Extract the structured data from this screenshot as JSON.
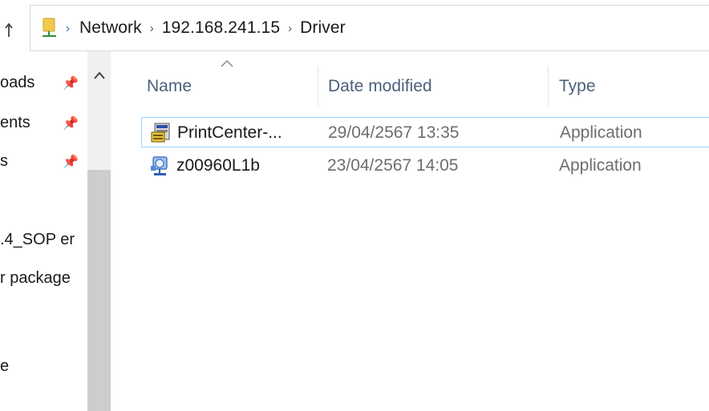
{
  "address": {
    "segments": [
      "Network",
      "192.168.241.15",
      "Driver"
    ]
  },
  "nav": {
    "items": [
      {
        "label": "oads",
        "pinned": true
      },
      {
        "label": "ents",
        "pinned": true
      },
      {
        "label": "s",
        "pinned": true
      },
      {
        "label": ".4_SOP er",
        "pinned": false
      },
      {
        "label": "r package",
        "pinned": false
      },
      {
        "label": "e",
        "pinned": false
      }
    ]
  },
  "columns": {
    "name": "Name",
    "date": "Date modified",
    "type": "Type"
  },
  "files": [
    {
      "name": "PrintCenter-...",
      "date": "29/04/2567 13:35",
      "type": "Application",
      "icon": "setup-installer-icon"
    },
    {
      "name": "z00960L1b",
      "date": "23/04/2567 14:05",
      "type": "Application",
      "icon": "network-app-icon"
    }
  ],
  "colors": {
    "selection_border": "#99d1ff",
    "header_text": "#4c607a",
    "secondary_text": "#6d6d6d"
  }
}
